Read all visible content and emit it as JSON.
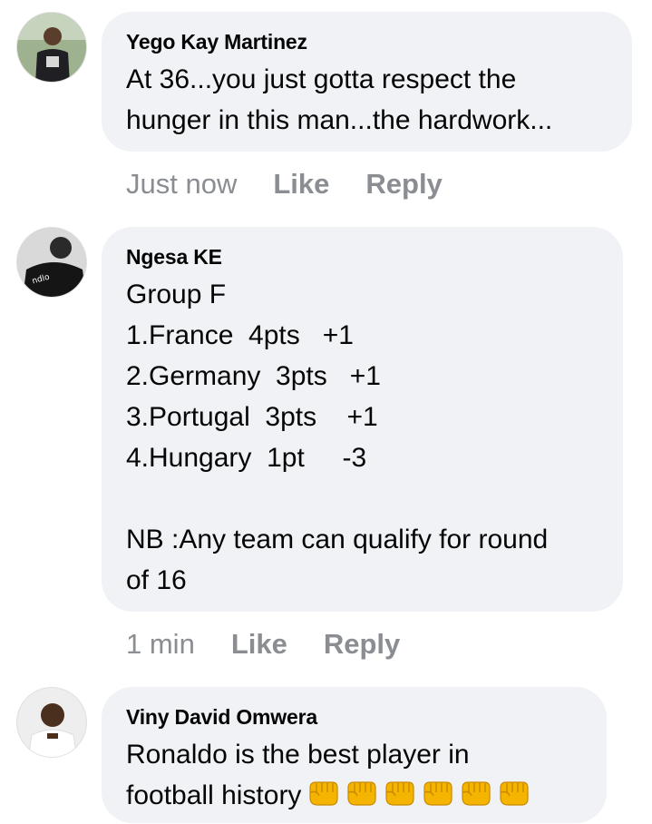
{
  "comments": [
    {
      "author": "Yego Kay Martinez",
      "text": "At 36...you just gotta respect the\nhunger in this man...the hardwork...",
      "time": "Just now",
      "like_label": "Like",
      "reply_label": "Reply",
      "avatar_icon": "profile-photo-man-in-black-shirt"
    },
    {
      "author": "Ngesa KE",
      "text": "Group F\n1.France  4pts   +1\n2.Germany  3pts   +1\n3.Portugal  3pts    +1\n4.Hungary  1pt     -3\n\nNB :Any team can qualify for round\nof 16",
      "time": "1 min",
      "like_label": "Like",
      "reply_label": "Reply",
      "avatar_icon": "profile-photo-black-and-white"
    },
    {
      "author": "Viny David Omwera",
      "text": "Ronaldo is the best player in\nfootball history",
      "emoji": "👊👊👊👊👊👊",
      "emoji_icon": "oncoming-fist-emoji",
      "emoji_count": 6,
      "avatar_icon": "profile-photo-man-in-white-shirt"
    }
  ],
  "colors": {
    "bubble_bg": "#f0f2f5",
    "text": "#050505",
    "meta": "#8a8d91",
    "fist": "#f4b400"
  }
}
